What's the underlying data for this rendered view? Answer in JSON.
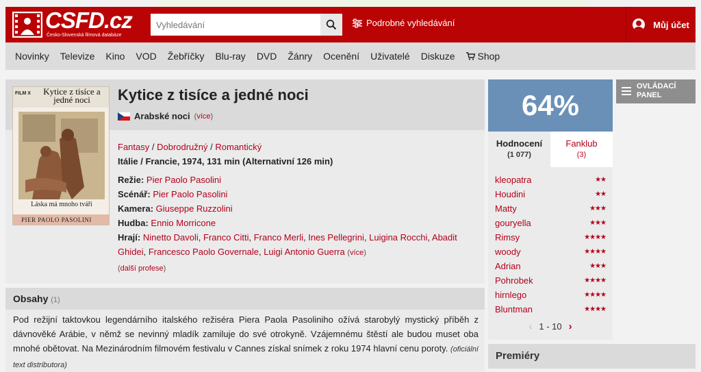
{
  "brand": {
    "logo_text": "CSFD.cz",
    "logo_subtitle": "Česko-Slovenská filmová databáze",
    "color_primary": "#ba0305",
    "color_rating": "#6a90b8"
  },
  "search": {
    "placeholder": "Vyhledávání",
    "value": "",
    "advanced_label": "Podrobné vyhledávání"
  },
  "account": {
    "label": "Můj účet"
  },
  "nav": {
    "items": [
      "Novinky",
      "Televize",
      "Kino",
      "VOD",
      "Žebříčky",
      "Blu-ray",
      "DVD",
      "Žánry",
      "Ocenění",
      "Uživatelé",
      "Diskuze",
      "Shop"
    ]
  },
  "film": {
    "title": "Kytice z tisíce a jedné noci",
    "alt_title": "Arabské noci",
    "alt_more": "více",
    "genres": [
      "Fantasy",
      "Dobrodružný",
      "Romantický"
    ],
    "origin": "Itálie / Francie, 1974, 131 min (Alternativní 126 min)",
    "crew": {
      "director_label": "Režie:",
      "director": "Pier Paolo Pasolini",
      "writer_label": "Scénář:",
      "writer": "Pier Paolo Pasolini",
      "camera_label": "Kamera:",
      "camera": "Giuseppe Ruzzolini",
      "music_label": "Hudba:",
      "music": "Ennio Morricone",
      "cast_label": "Hrají:",
      "cast": [
        "Ninetto Davoli",
        "Franco Citti",
        "Franco Merli",
        "Ines Pellegrini",
        "Luigina Rocchi",
        "Abadit Ghidei",
        "Francesco Paolo Governale",
        "Luigi Antonio Guerra"
      ],
      "cast_more": "více",
      "more_professions": "další profese"
    },
    "poster": {
      "title": "Kytice z tisíce a jedné noci",
      "badge": "FILM X",
      "subtitle": "Láska má mnoho tváří",
      "director": "PIER PAOLO PASOLINI"
    }
  },
  "plot": {
    "heading": "Obsahy",
    "count": "(1)",
    "text": "Pod režijní taktovkou legendárního italského režiséra Piera Paola Pasoliniho ožívá starobylý mystický příběh z dávnověké Arábie, v němž se nevinný mladík zamiluje do své otrokyně. Vzájemnému štěstí ale budou muset oba mnohé obětovat. Na Mezinárodním filmovém festivalu v Cannes získal snímek z roku 1974 hlavní cenu poroty.",
    "source": "(oficiální text distributora)"
  },
  "rating": {
    "percent": "64%",
    "tab_ratings": "Hodnocení",
    "tab_ratings_count": "(1 077)",
    "tab_fanclub": "Fanklub",
    "tab_fanclub_count": "(3)",
    "users": [
      {
        "name": "kleopatra",
        "stars": 2
      },
      {
        "name": "Houdini",
        "stars": 2
      },
      {
        "name": "Matty",
        "stars": 3
      },
      {
        "name": "gouryella",
        "stars": 3
      },
      {
        "name": "Rimsy",
        "stars": 4
      },
      {
        "name": "woody",
        "stars": 4
      },
      {
        "name": "Adrian",
        "stars": 3
      },
      {
        "name": "Pohrobek",
        "stars": 4
      },
      {
        "name": "hirnlego",
        "stars": 4
      },
      {
        "name": "Bluntman",
        "stars": 4
      }
    ],
    "pager": "1 - 10"
  },
  "control_panel": {
    "label": "OVLÁDACÍ PANEL"
  },
  "premiery": {
    "label": "Premiéry"
  }
}
